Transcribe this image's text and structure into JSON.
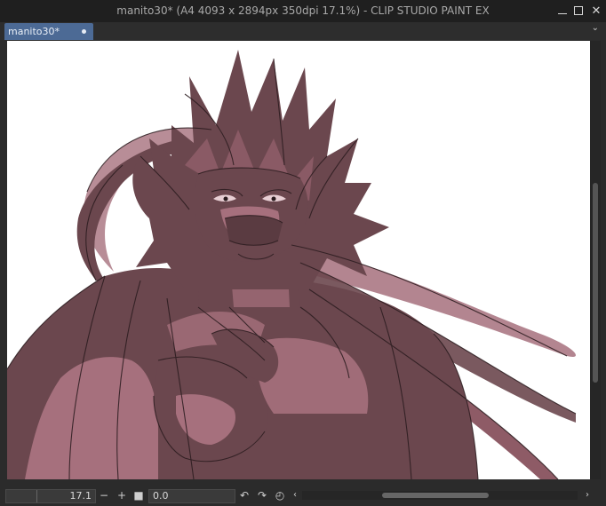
{
  "window": {
    "title": "manito30* (A4 4093 x 2894px 350dpi 17.1%)  - CLIP STUDIO PAINT EX"
  },
  "tab": {
    "label": "manito30*"
  },
  "canvas": {
    "accent": "#4c6a95",
    "shade_dark": "#6b474e",
    "shade_light": "#a6707d",
    "line": "#2a1b1e"
  },
  "statusbar": {
    "zoom_value": "17.1",
    "zoom_out_label": "−",
    "zoom_in_label": "+",
    "rotation_value": "0.0",
    "icons": [
      "square-icon",
      "rotate-left-icon",
      "rotate-right-icon",
      "reset-rotation-icon",
      "chevron-left-icon",
      "chevron-right-icon"
    ]
  }
}
